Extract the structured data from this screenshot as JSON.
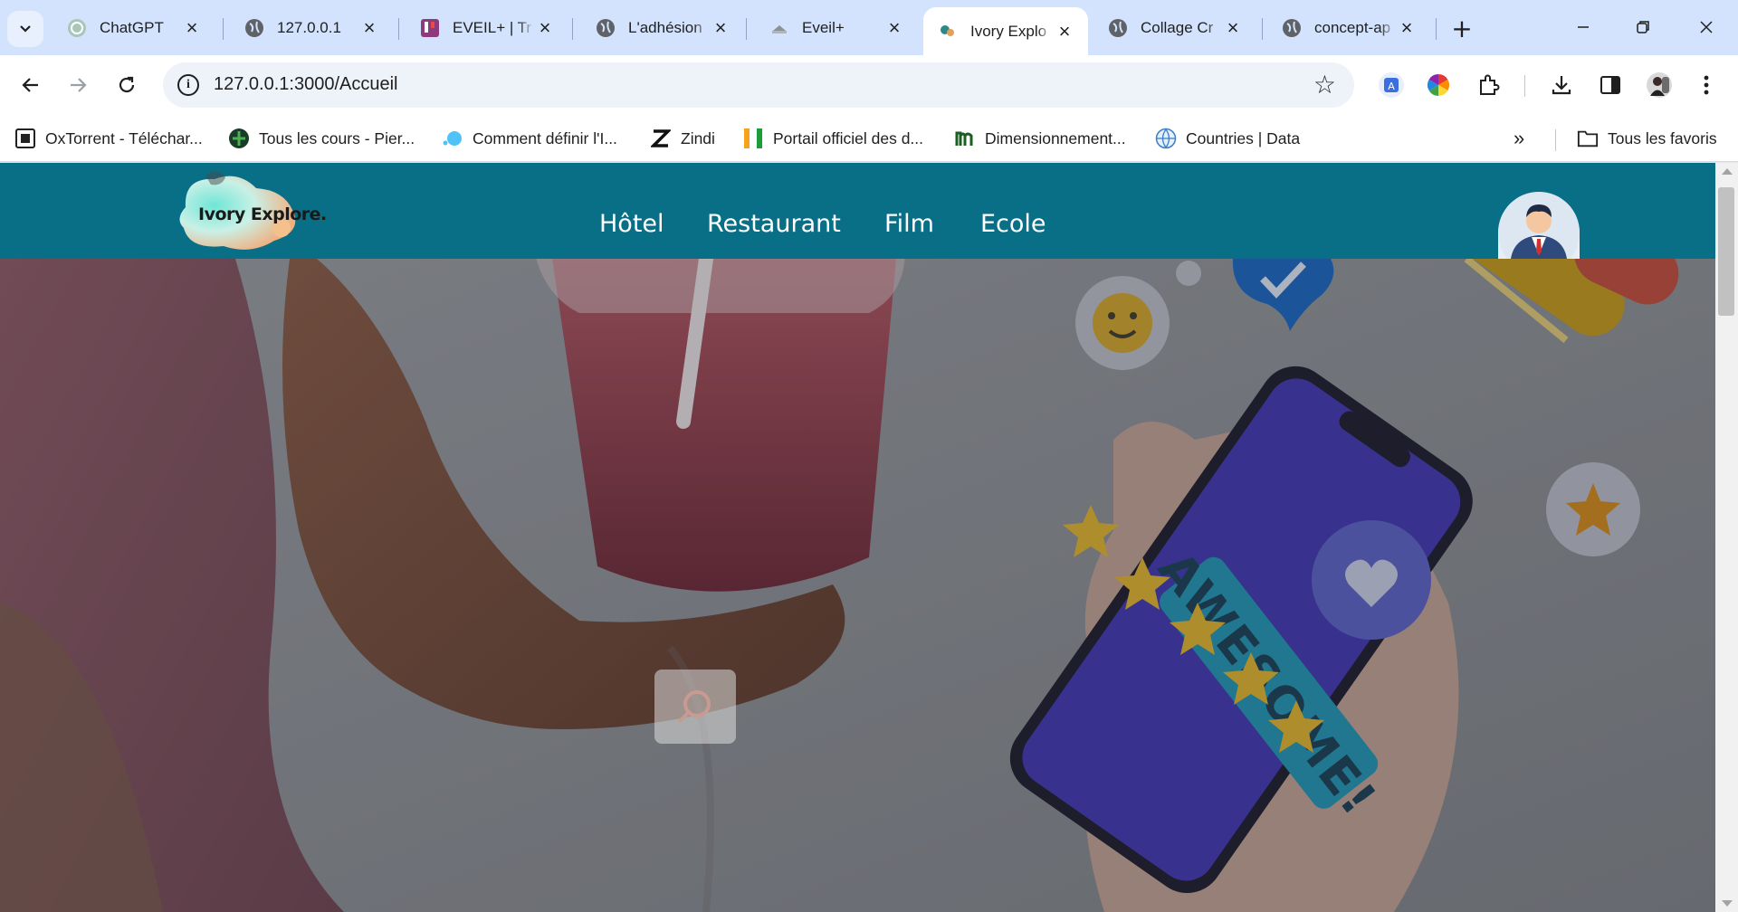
{
  "browser": {
    "tabs": [
      {
        "title": "ChatGPT",
        "icon": "chatgpt-icon"
      },
      {
        "title": "127.0.0.1",
        "icon": "globe-icon"
      },
      {
        "title": "EVEIL+ | Tr",
        "icon": "trello-icon"
      },
      {
        "title": "L'adhésion",
        "icon": "globe-icon"
      },
      {
        "title": "Eveil+",
        "icon": "eveil-icon"
      },
      {
        "title": "Ivory Explo",
        "icon": "ivory-favicon",
        "active": true
      },
      {
        "title": "Collage Cr",
        "icon": "globe-icon"
      },
      {
        "title": "concept-ap",
        "icon": "globe-icon"
      }
    ],
    "url": "127.0.0.1:3000/Accueil",
    "bookmarks": [
      {
        "label": "OxTorrent - Téléchar...",
        "icon": "oxtorrent-icon"
      },
      {
        "label": "Tous les cours - Pier...",
        "icon": "courses-icon"
      },
      {
        "label": "Comment définir l'I...",
        "icon": "dot-icon"
      },
      {
        "label": "Zindi",
        "icon": "zindi-icon"
      },
      {
        "label": "Portail officiel des d...",
        "icon": "flag-icon"
      },
      {
        "label": "Dimensionnement...",
        "icon": "m-icon"
      },
      {
        "label": "Countries | Data",
        "icon": "countries-icon"
      }
    ],
    "all_bookmarks_label": "Tous les favoris"
  },
  "site": {
    "logo_text": "Ivory Explore.",
    "nav": [
      "Hôtel",
      "Restaurant",
      "Film",
      "Ecole"
    ],
    "hero": {
      "phone_text": "AWESOME!",
      "stars_on_phone": 5
    }
  },
  "colors": {
    "header_bg": "#086f86",
    "tabstrip_bg": "#d3e3fd",
    "phone_screen": "#3f37b3",
    "banner": "#1e96b4",
    "star": "#e2b62c"
  }
}
